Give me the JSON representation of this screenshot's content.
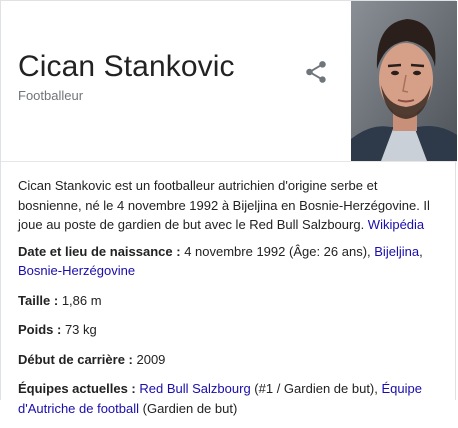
{
  "header": {
    "title": "Cican Stankovic",
    "subtitle": "Footballeur"
  },
  "icons": {
    "share": "share-icon"
  },
  "description": {
    "text": "Cican Stankovic est un footballeur autrichien d'origine serbe et bosnienne, né le 4 novembre 1992 à Bijeljina en Bosnie-Herzégovine. Il joue au poste de gardien de but avec le Red Bull Salzbourg. ",
    "source_link": "Wikipédia"
  },
  "facts": {
    "birth": {
      "label": "Date et lieu de naissance :",
      "value": " 4 novembre 1992 (Âge: 26 ans), ",
      "link1": "Bijeljina",
      "sep": ", ",
      "link2": "Bosnie-Herzégovine"
    },
    "height": {
      "label": "Taille :",
      "value": " 1,86 m"
    },
    "weight": {
      "label": "Poids :",
      "value": " 73 kg"
    },
    "career_start": {
      "label": "Début de carrière :",
      "value": " 2009"
    },
    "teams": {
      "label": "Équipes actuelles :",
      "link1": "Red Bull Salzbourg",
      "text1": " (#1 / Gardien de but), ",
      "link2": "Équipe d'Autriche de football",
      "text2": " (Gardien de but)"
    }
  },
  "colors": {
    "link": "#1a0dab",
    "subtitle": "#70757a",
    "text": "#222222",
    "border": "#dfe1e5"
  }
}
